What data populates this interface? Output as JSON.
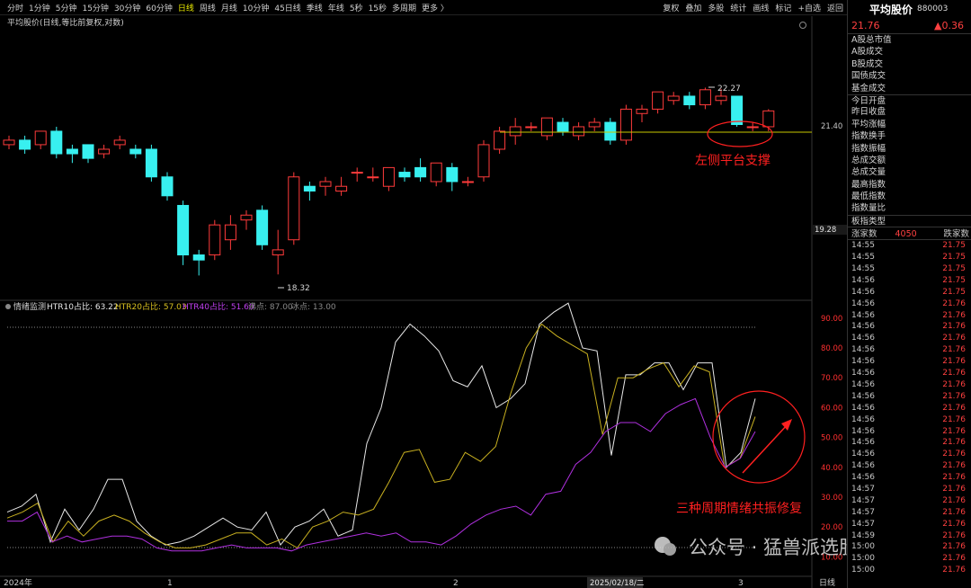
{
  "toolbar": {
    "timeframes": [
      "分时",
      "1分钟",
      "5分钟",
      "15分钟",
      "30分钟",
      "60分钟",
      "日线",
      "周线",
      "月线",
      "10分钟",
      "45日线",
      "季线",
      "年线",
      "5秒",
      "15秒",
      "多周期",
      "更多 〉"
    ],
    "active_timeframe": "日线",
    "tools": [
      "复权",
      "叠加",
      "多股",
      "统计",
      "画线",
      "标记",
      "+自选",
      "返回"
    ]
  },
  "main_chart": {
    "title": "平均股价(日线,等比前复权,对数)",
    "axis_labels": [
      "21.40",
      "19.28"
    ],
    "max_label": "22.27",
    "min_label": "18.32",
    "annotation": "左侧平台支撑",
    "up_color": "#ff3b3b",
    "down_color": "#38f0f0"
  },
  "indicator": {
    "name": "情绪监测",
    "htr10": "HTR10占比: 63.22",
    "htr20": "HTR20占比: 57.03",
    "htr40": "HTR40占比: 51.60",
    "boil": "沸点: 87.00",
    "freeze": "冰点: 13.00",
    "axis_labels": [
      "90.00",
      "80.00",
      "70.00",
      "60.00",
      "50.00",
      "40.00",
      "30.00",
      "20.00",
      "10.00"
    ],
    "annotation": "三种周期情绪共振修复",
    "colors": {
      "htr10": "#e8e8e8",
      "htr20": "#c8b020",
      "htr40": "#b030e0"
    }
  },
  "date_axis": {
    "labels": [
      "2024年",
      "1",
      "2",
      "2025/02/18/二",
      "3"
    ],
    "mode": "日线"
  },
  "watermark": "公众号 · 猛兽派选股",
  "quote": {
    "name": "平均股价",
    "code": "880003",
    "price": "21.76",
    "change": "▲0.36",
    "items": [
      "A股总市值",
      "A股成交",
      "B股成交",
      "国债成交",
      "基金成交",
      "今日开盘",
      "昨日收盘",
      "平均涨幅",
      "指数换手",
      "指数振幅",
      "总成交额",
      "总成交量",
      "最高指数",
      "最低指数",
      "指数量比",
      "板指类型"
    ],
    "up_label": "涨家数",
    "up_count": "4050",
    "down_label": "跌家数"
  },
  "ticks": [
    {
      "t": "14:55",
      "v": "21.75"
    },
    {
      "t": "14:55",
      "v": "21.75"
    },
    {
      "t": "14:55",
      "v": "21.75"
    },
    {
      "t": "14:56",
      "v": "21.75"
    },
    {
      "t": "14:56",
      "v": "21.75"
    },
    {
      "t": "14:56",
      "v": "21.76"
    },
    {
      "t": "14:56",
      "v": "21.76"
    },
    {
      "t": "14:56",
      "v": "21.76"
    },
    {
      "t": "14:56",
      "v": "21.76"
    },
    {
      "t": "14:56",
      "v": "21.76"
    },
    {
      "t": "14:56",
      "v": "21.76"
    },
    {
      "t": "14:56",
      "v": "21.76"
    },
    {
      "t": "14:56",
      "v": "21.76"
    },
    {
      "t": "14:56",
      "v": "21.76"
    },
    {
      "t": "14:56",
      "v": "21.76"
    },
    {
      "t": "14:56",
      "v": "21.76"
    },
    {
      "t": "14:56",
      "v": "21.76"
    },
    {
      "t": "14:56",
      "v": "21.76"
    },
    {
      "t": "14:56",
      "v": "21.76"
    },
    {
      "t": "14:56",
      "v": "21.76"
    },
    {
      "t": "14:56",
      "v": "21.76"
    },
    {
      "t": "14:57",
      "v": "21.76"
    },
    {
      "t": "14:57",
      "v": "21.76"
    },
    {
      "t": "14:57",
      "v": "21.76"
    },
    {
      "t": "14:57",
      "v": "21.76"
    },
    {
      "t": "14:59",
      "v": "21.76"
    },
    {
      "t": "15:00",
      "v": "21.76"
    },
    {
      "t": "15:00",
      "v": "21.76"
    },
    {
      "t": "15:00",
      "v": "21.76"
    }
  ],
  "candles": [
    [
      21.0,
      21.1,
      20.9,
      21.2
    ],
    [
      21.1,
      20.9,
      20.8,
      21.2
    ],
    [
      21.0,
      21.3,
      20.9,
      21.3
    ],
    [
      21.3,
      20.8,
      20.7,
      21.4
    ],
    [
      20.9,
      20.8,
      20.6,
      21.0
    ],
    [
      21.0,
      20.7,
      20.6,
      21.0
    ],
    [
      20.8,
      20.9,
      20.7,
      21.0
    ],
    [
      21.0,
      21.1,
      20.9,
      21.2
    ],
    [
      20.9,
      20.8,
      20.7,
      21.0
    ],
    [
      20.9,
      20.3,
      20.2,
      21.0
    ],
    [
      20.3,
      19.9,
      19.8,
      20.4
    ],
    [
      19.7,
      18.7,
      18.5,
      19.8
    ],
    [
      18.7,
      18.6,
      18.3,
      18.8
    ],
    [
      18.7,
      19.3,
      18.6,
      19.4
    ],
    [
      19.0,
      19.3,
      18.8,
      19.5
    ],
    [
      19.4,
      19.5,
      19.2,
      19.6
    ],
    [
      19.6,
      18.9,
      18.8,
      19.7
    ],
    [
      18.7,
      18.8,
      18.32,
      19.2
    ],
    [
      19.0,
      20.3,
      18.9,
      20.4
    ],
    [
      20.1,
      20.0,
      19.8,
      20.2
    ],
    [
      20.1,
      20.2,
      19.9,
      20.3
    ],
    [
      20.0,
      20.1,
      19.9,
      20.3
    ],
    [
      20.4,
      20.4,
      20.2,
      20.5
    ],
    [
      20.3,
      20.3,
      20.2,
      20.5
    ],
    [
      20.1,
      20.5,
      20.0,
      20.5
    ],
    [
      20.4,
      20.3,
      20.2,
      20.5
    ],
    [
      20.5,
      20.3,
      20.2,
      20.7
    ],
    [
      20.2,
      20.6,
      20.1,
      20.6
    ],
    [
      20.5,
      20.2,
      20.0,
      20.6
    ],
    [
      20.2,
      20.2,
      20.1,
      20.3
    ],
    [
      20.3,
      21.0,
      20.2,
      21.1
    ],
    [
      20.9,
      21.3,
      20.8,
      21.4
    ],
    [
      21.2,
      21.4,
      21.0,
      21.6
    ],
    [
      21.4,
      21.4,
      21.3,
      21.5
    ],
    [
      21.2,
      21.6,
      21.1,
      21.6
    ],
    [
      21.5,
      21.3,
      21.2,
      21.6
    ],
    [
      21.2,
      21.4,
      21.1,
      21.5
    ],
    [
      21.4,
      21.5,
      21.3,
      21.6
    ],
    [
      21.5,
      21.1,
      21.0,
      21.6
    ],
    [
      21.1,
      21.8,
      21.0,
      21.9
    ],
    [
      21.7,
      21.8,
      21.5,
      21.9
    ],
    [
      21.8,
      22.2,
      21.7,
      22.2
    ],
    [
      22.0,
      22.1,
      21.9,
      22.2
    ],
    [
      22.1,
      21.9,
      21.8,
      22.2
    ],
    [
      21.9,
      22.25,
      21.8,
      22.3
    ],
    [
      22.0,
      22.1,
      21.9,
      22.27
    ],
    [
      22.1,
      21.45,
      21.4,
      22.1
    ],
    [
      21.4,
      21.4,
      21.3,
      21.5
    ],
    [
      21.4,
      21.76,
      21.3,
      21.8
    ]
  ],
  "htr10": [
    25,
    27,
    31,
    15,
    26,
    19,
    26,
    36,
    36,
    22,
    17,
    14,
    15,
    17,
    20,
    23,
    20,
    19,
    25,
    14,
    20,
    22,
    26,
    17,
    19,
    48,
    60,
    82,
    88,
    84,
    79,
    69,
    67,
    74,
    60,
    63,
    68,
    88,
    92,
    95,
    80,
    79,
    44,
    71,
    71,
    75,
    75,
    66,
    75,
    75,
    40,
    45,
    63
  ],
  "htr20": [
    23,
    25,
    28,
    15,
    22,
    17,
    22,
    24,
    22,
    18,
    15,
    13,
    13,
    14,
    16,
    18,
    18,
    14,
    16,
    13,
    20,
    22,
    25,
    24,
    26,
    35,
    45,
    46,
    35,
    36,
    45,
    42,
    47,
    65,
    80,
    88,
    84,
    81,
    78,
    51,
    70,
    70,
    73,
    75,
    67,
    74,
    72,
    40,
    43,
    57
  ],
  "htr40": [
    22,
    22,
    25,
    15,
    17,
    15,
    16,
    17,
    17,
    16,
    13,
    12,
    12,
    12,
    13,
    14,
    13,
    13,
    13,
    12,
    14,
    15,
    16,
    17,
    18,
    17,
    18,
    15,
    15,
    14,
    17,
    21,
    24,
    26,
    27,
    24,
    31,
    32,
    41,
    45,
    52,
    55,
    55,
    52,
    58,
    61,
    63,
    50,
    40,
    43,
    52
  ]
}
